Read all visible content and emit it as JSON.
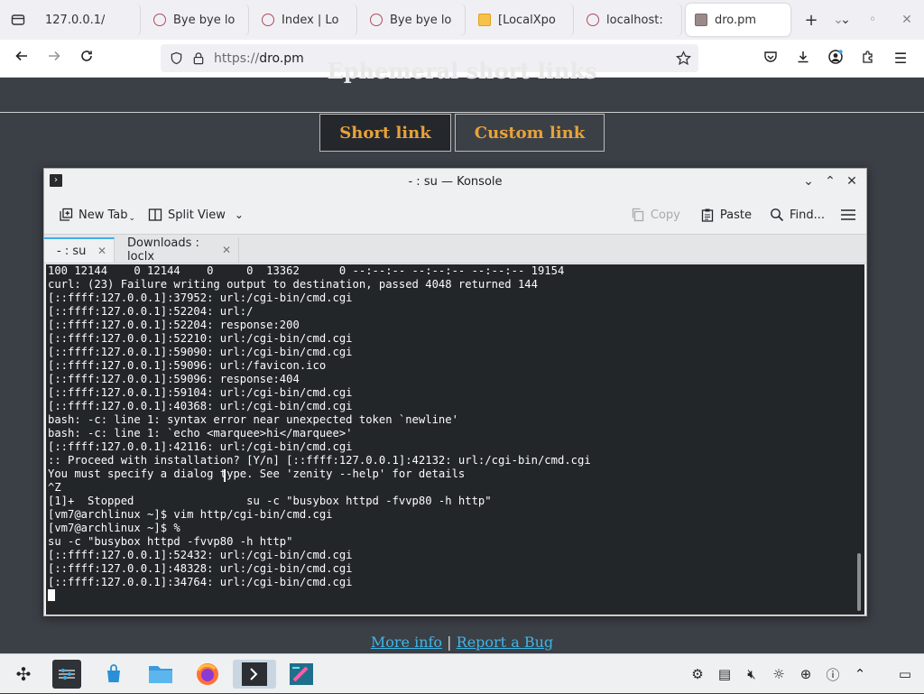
{
  "browser": {
    "tabs": [
      {
        "title": "127.0.0.1/",
        "favicon": "none",
        "active": false
      },
      {
        "title": "Bye bye lo",
        "favicon": "circle-x",
        "active": false
      },
      {
        "title": "Index | Lo",
        "favicon": "circle-x",
        "active": false
      },
      {
        "title": "Bye bye lo",
        "favicon": "circle-x",
        "active": false
      },
      {
        "title": "[LocalXpo",
        "favicon": "mail",
        "active": false
      },
      {
        "title": "localhost:",
        "favicon": "circle-x",
        "active": false
      },
      {
        "title": "dro.pm",
        "favicon": "page",
        "active": true
      }
    ],
    "url_proto": "https://",
    "url_host": "dro.pm"
  },
  "page": {
    "heading": "Ephemeral short links",
    "short_link_label": "Short link",
    "custom_link_label": "Custom link",
    "more_info_label": "More info",
    "separator": "|",
    "report_bug_label": "Report a Bug"
  },
  "konsole": {
    "title": "- : su — Konsole",
    "toolbar": {
      "new_tab": "New Tab",
      "split_view": "Split View",
      "copy": "Copy",
      "paste": "Paste",
      "find": "Find..."
    },
    "tabs": [
      {
        "label": "- : su"
      },
      {
        "label": "Downloads : loclx"
      }
    ],
    "lines": [
      "100 12144    0 12144    0     0  13362      0 --:--:-- --:--:-- --:--:-- 19154",
      "curl: (23) Failure writing output to destination, passed 4048 returned 144",
      "[::ffff:127.0.0.1]:37952: url:/cgi-bin/cmd.cgi",
      "[::ffff:127.0.0.1]:52204: url:/",
      "[::ffff:127.0.0.1]:52204: response:200",
      "[::ffff:127.0.0.1]:52210: url:/cgi-bin/cmd.cgi",
      "[::ffff:127.0.0.1]:59090: url:/cgi-bin/cmd.cgi",
      "[::ffff:127.0.0.1]:59096: url:/favicon.ico",
      "[::ffff:127.0.0.1]:59096: response:404",
      "[::ffff:127.0.0.1]:59104: url:/cgi-bin/cmd.cgi",
      "[::ffff:127.0.0.1]:40368: url:/cgi-bin/cmd.cgi",
      "bash: -c: line 1: syntax error near unexpected token `newline'",
      "bash: -c: line 1: `echo <marquee>hi</marquee>'",
      "[::ffff:127.0.0.1]:42116: url:/cgi-bin/cmd.cgi",
      ":: Proceed with installation? [Y/n] [::ffff:127.0.0.1]:42132: url:/cgi-bin/cmd.cgi",
      "You must specify a dialog type. See 'zenity --help' for details",
      "^Z",
      "[1]+  Stopped                 su -c \"busybox httpd -fvvp80 -h http\"",
      "[vm7@archlinux ~]$ vim http/cgi-bin/cmd.cgi",
      "[vm7@archlinux ~]$ %",
      "su -c \"busybox httpd -fvvp80 -h http\"",
      "[::ffff:127.0.0.1]:52432: url:/cgi-bin/cmd.cgi",
      "[::ffff:127.0.0.1]:48328: url:/cgi-bin/cmd.cgi",
      "[::ffff:127.0.0.1]:34764: url:/cgi-bin/cmd.cgi"
    ]
  },
  "taskbar": {
    "items": [
      "app-launcher",
      "system-settings",
      "discover",
      "dolphin-files",
      "firefox",
      "konsole",
      "kate"
    ],
    "tray": [
      "network-share-icon",
      "clipboard-icon",
      "volume-muted-icon",
      "brightness-icon",
      "network-icon",
      "help-icon",
      "tray-expand-icon",
      "show-desktop-icon"
    ]
  },
  "colors": {
    "page_bg": "#3b3f46",
    "accent_orange": "#e8a23a",
    "link_blue": "#3fb6e6",
    "terminal_bg": "#232629",
    "terminal_fg": "#fcfcfc"
  }
}
